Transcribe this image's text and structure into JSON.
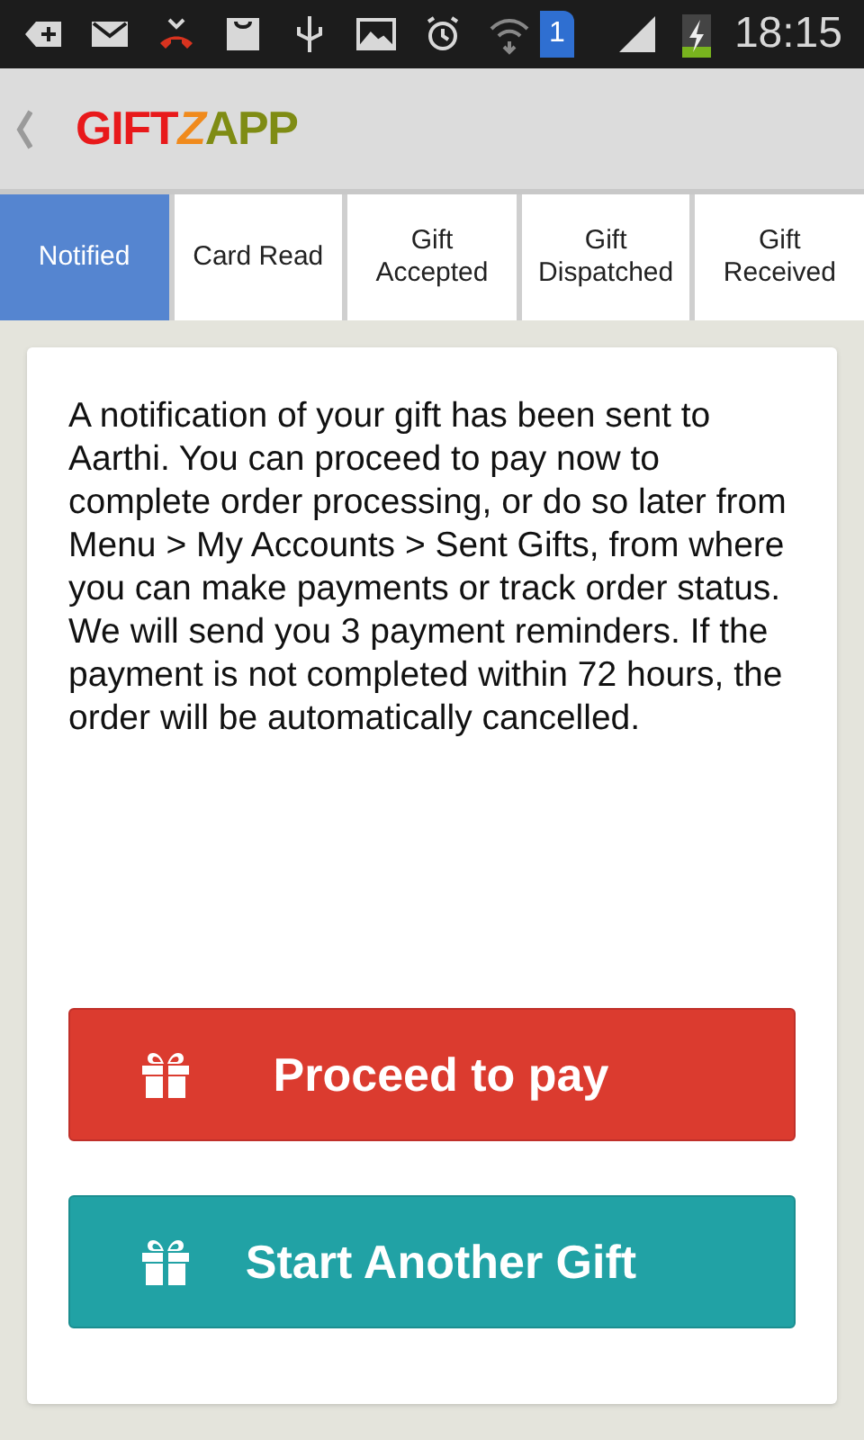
{
  "status_bar": {
    "sim_badge": "1",
    "time": "18:15"
  },
  "app_bar": {
    "logo": [
      {
        "text": "GIFT",
        "color": "#e8191b"
      },
      {
        "text": "Z",
        "color": "#f08a1c"
      },
      {
        "text": "APP",
        "color": "#7f8c14"
      }
    ]
  },
  "tabs": [
    {
      "label": "Notified",
      "selected": true
    },
    {
      "label": "Card Read",
      "selected": false
    },
    {
      "label": "Gift Accepted",
      "selected": false
    },
    {
      "label": "Gift Dispatched",
      "selected": false
    },
    {
      "label": "Gift Received",
      "selected": false
    }
  ],
  "message": "A notification of your gift has been sent to Aarthi. You can proceed to pay now to complete order processing, or do so later from Menu > My Accounts > Sent Gifts, from where you can make payments or track order status. We will send you 3 payment reminders. If the payment is not completed within 72 hours, the order will be automatically cancelled.",
  "buttons": [
    {
      "label": "Proceed to pay",
      "kind": "primary"
    },
    {
      "label": "Start Another Gift",
      "kind": "secondary"
    }
  ]
}
